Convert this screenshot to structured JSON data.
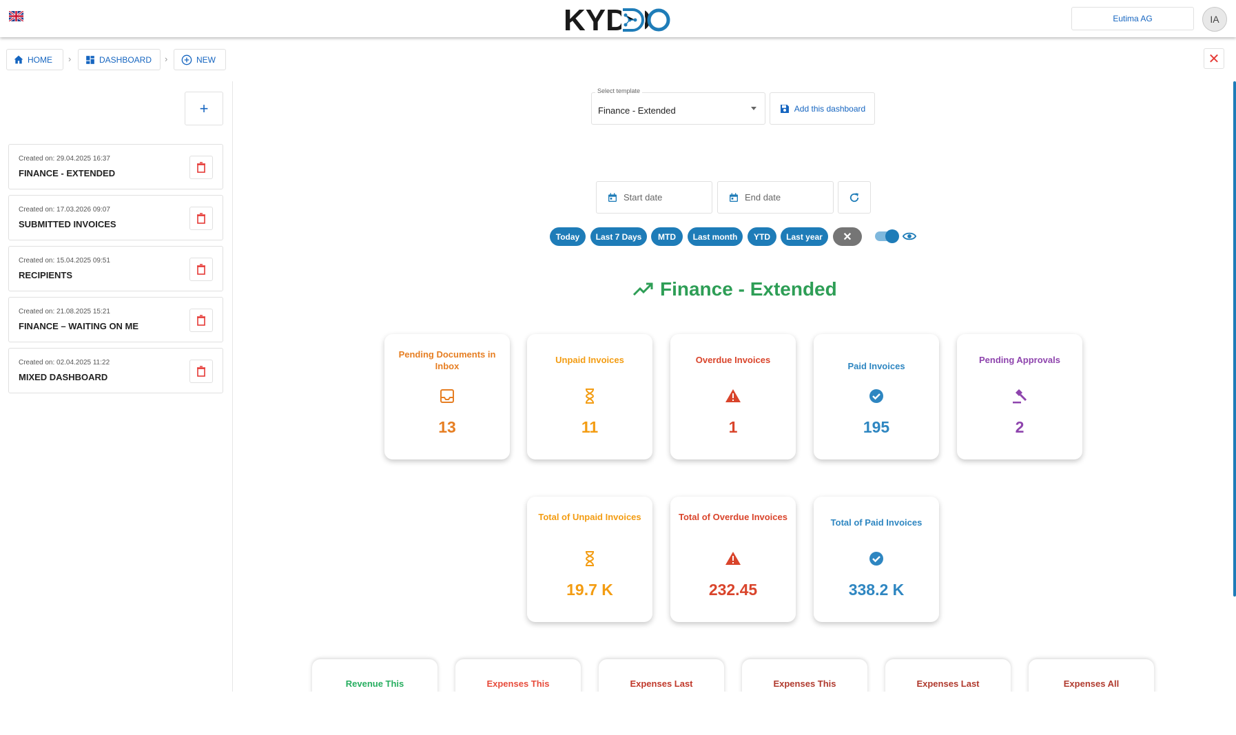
{
  "header": {
    "logo_text": "KYDO",
    "company": "Eutima AG",
    "avatar_initials": "IA"
  },
  "breadcrumb": {
    "home": "HOME",
    "dashboard": "DASHBOARD",
    "new": "NEW"
  },
  "sidebar": {
    "items": [
      {
        "created": "Created on: 29.04.2025 16:37",
        "name": "FINANCE - EXTENDED"
      },
      {
        "created": "Created on: 17.03.2026 09:07",
        "name": "SUBMITTED INVOICES"
      },
      {
        "created": "Created on: 15.04.2025 09:51",
        "name": "RECIPIENTS"
      },
      {
        "created": "Created on: 21.08.2025 15:21",
        "name": "FINANCE – WAITING ON ME"
      },
      {
        "created": "Created on: 02.04.2025 11:22",
        "name": "MIXED DASHBOARD"
      }
    ]
  },
  "template": {
    "label": "Select template",
    "value": "Finance - Extended",
    "add_label": "Add this dashboard"
  },
  "dates": {
    "start_placeholder": "Start date",
    "end_placeholder": "End date"
  },
  "chips": [
    "Today",
    "Last 7 Days",
    "MTD",
    "Last month",
    "YTD",
    "Last year"
  ],
  "dashboard_title": "Finance - Extended",
  "kpis_row1": [
    {
      "title": "Pending Documents in Inbox",
      "value": "13",
      "color": "#e67e22",
      "icon": "inbox-icon"
    },
    {
      "title": "Unpaid Invoices",
      "value": "11",
      "color": "#f39c12",
      "icon": "hourglass-icon"
    },
    {
      "title": "Overdue Invoices",
      "value": "1",
      "color": "#d9442b",
      "icon": "warning-icon"
    },
    {
      "title": "Paid Invoices",
      "value": "195",
      "color": "#2e86c1",
      "icon": "check-circle-icon"
    },
    {
      "title": "Pending Approvals",
      "value": "2",
      "color": "#8e44ad",
      "icon": "gavel-icon"
    }
  ],
  "kpis_row2": [
    {
      "title": "Total of Unpaid Invoices",
      "value": "19.7 K",
      "color": "#f39c12",
      "icon": "hourglass-icon"
    },
    {
      "title": "Total of Overdue Invoices",
      "value": "232.45",
      "color": "#d9442b",
      "icon": "warning-icon"
    },
    {
      "title": "Total of Paid Invoices",
      "value": "338.2 K",
      "color": "#2e86c1",
      "icon": "check-circle-icon"
    }
  ],
  "kpis_row3": [
    {
      "title": "Revenue This",
      "color": "#27ae60"
    },
    {
      "title": "Expenses This",
      "color": "#e74c3c"
    },
    {
      "title": "Expenses Last",
      "color": "#c0392b"
    },
    {
      "title": "Expenses This",
      "color": "#b03a2e"
    },
    {
      "title": "Expenses Last",
      "color": "#b03a2e"
    },
    {
      "title": "Expenses All",
      "color": "#b03a2e"
    }
  ]
}
